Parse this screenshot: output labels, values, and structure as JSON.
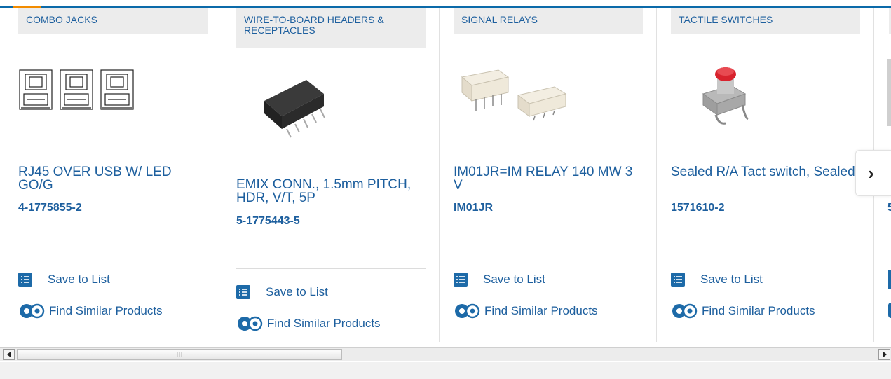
{
  "products": [
    {
      "category": "COMBO JACKS",
      "title": "RJ45 OVER USB W/ LED GO/G",
      "part_number": "4-1775855-2",
      "save_label": "Save to List",
      "similar_label": "Find Similar Products"
    },
    {
      "category": "WIRE-TO-BOARD HEADERS & RECEPTACLES",
      "title": "EMIX CONN., 1.5mm PITCH, HDR, V/T, 5P",
      "part_number": "5-1775443-5",
      "save_label": "Save to List",
      "similar_label": "Find Similar Products"
    },
    {
      "category": "SIGNAL RELAYS",
      "title": "IM01JR=IM RELAY 140 MW 3 V",
      "part_number": "IM01JR",
      "save_label": "Save to List",
      "similar_label": "Find Similar Products"
    },
    {
      "category": "TACTILE SWITCHES",
      "title": "Sealed R/A Tact switch, Sealed",
      "part_number": "1571610-2",
      "save_label": "Save to List",
      "similar_label": "Find Similar Products"
    }
  ],
  "partial_part_number_char": "5",
  "carousel": {
    "next_icon": "chevron-right-icon",
    "next_glyph": "›"
  },
  "colors": {
    "brand_blue": "#1d5f9e",
    "top_bar": "#0b6aa9",
    "accent_orange": "#f28c00"
  }
}
